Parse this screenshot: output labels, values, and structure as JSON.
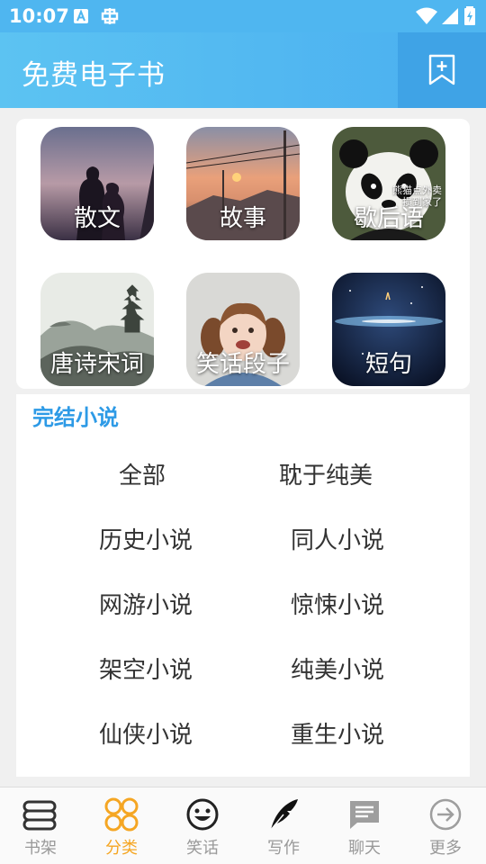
{
  "status_bar": {
    "time": "10:07"
  },
  "app_bar": {
    "title": "免费电子书",
    "bookmark_icon": "bookmark-add-icon"
  },
  "categories_grid": [
    {
      "label": "散文"
    },
    {
      "label": "故事"
    },
    {
      "label": "歇后语",
      "subtitle_line1": "熊猫点外卖",
      "subtitle_line2": "损到家了"
    },
    {
      "label": "唐诗宋词"
    },
    {
      "label": "笑话段子"
    },
    {
      "label": "短句"
    }
  ],
  "completed_novels": {
    "heading": "完结小说",
    "items": [
      "全部",
      "耽于纯美",
      "历史小说",
      "同人小说",
      "网游小说",
      "惊悚小说",
      "架空小说",
      "纯美小说",
      "仙侠小说",
      "重生小说"
    ]
  },
  "bottom_nav": {
    "active_color": "#f5a623",
    "items": [
      {
        "label": "书架",
        "icon": "bookshelf-icon"
      },
      {
        "label": "分类",
        "icon": "category-icon"
      },
      {
        "label": "笑话",
        "icon": "smiley-icon"
      },
      {
        "label": "写作",
        "icon": "quill-icon"
      },
      {
        "label": "聊天",
        "icon": "chat-icon"
      },
      {
        "label": "更多",
        "icon": "arrow-right-circle-icon"
      }
    ]
  }
}
